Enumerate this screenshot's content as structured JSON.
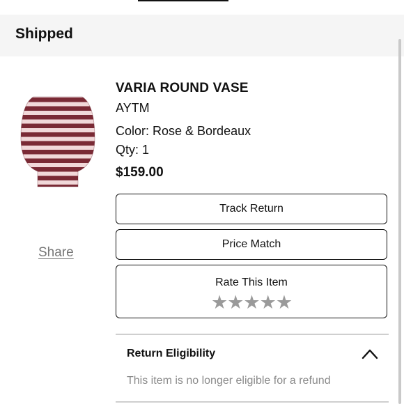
{
  "status": {
    "title": "Shipped"
  },
  "product": {
    "name": "VARIA ROUND VASE",
    "brand": "AYTM",
    "color": "Color: Rose & Bordeaux",
    "qty": "Qty: 1",
    "price": "$159.00",
    "image_icon": "striped-vase-image",
    "colors": {
      "rose": "#f1d8d9",
      "bordeaux": "#7a2a35"
    }
  },
  "share": {
    "label": "Share"
  },
  "actions": {
    "track_return": "Track Return",
    "price_match": "Price Match"
  },
  "rating": {
    "label": "Rate This Item",
    "stars": [
      "★",
      "★",
      "★",
      "★",
      "★"
    ],
    "max": 5,
    "value": 0
  },
  "return_eligibility": {
    "title": "Return Eligibility",
    "message": "This item is no longer eligible for a refund",
    "expanded": true
  }
}
